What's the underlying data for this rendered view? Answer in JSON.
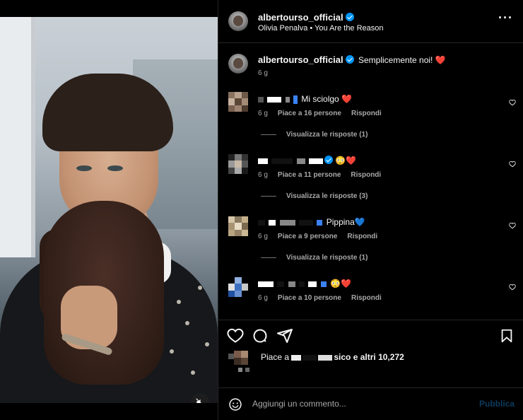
{
  "post": {
    "author": "albertourso_official",
    "audio": "Olivia Penalva • You Are the Reason",
    "caption": "Semplicemente noi!",
    "caption_emoji": "❤️",
    "caption_time": "6 g"
  },
  "comments": [
    {
      "text": "Mi sciolgo",
      "emoji": "❤️",
      "time": "6 g",
      "likes": "Piace a 16 persone",
      "reply": "Rispondi",
      "view_replies": "Visualizza le risposte (1)"
    },
    {
      "text": "",
      "emoji": "😳❤️",
      "time": "6 g",
      "likes": "Piace a 11 persone",
      "reply": "Rispondi",
      "view_replies": "Visualizza le risposte (3)"
    },
    {
      "text": "Pippina",
      "emoji": "💙",
      "time": "6 g",
      "likes": "Piace a 9 persone",
      "reply": "Rispondi",
      "view_replies": "Visualizza le risposte (1)"
    },
    {
      "text": "",
      "emoji": "😳❤️",
      "time": "6 g",
      "likes": "Piace a 10 persone",
      "reply": "Rispondi",
      "view_replies": ""
    }
  ],
  "likes_summary": {
    "prefix": "Piace a",
    "name_suffix": "sico",
    "rest": "e altri 10,272"
  },
  "composer": {
    "placeholder": "Aggiungi un commento...",
    "publish": "Pubblica"
  },
  "icons": {
    "more": "more-options-icon",
    "like": "heart-icon",
    "comment": "comment-icon",
    "share": "share-icon",
    "save": "bookmark-icon",
    "emoji": "emoji-icon",
    "mute": "speaker-muted-icon"
  },
  "colors": {
    "background": "#000000",
    "text": "#f5f5f5",
    "secondary": "#a8a8a8",
    "verified": "#0095f6",
    "publish_disabled": "#0c3b5e",
    "divider": "#262626"
  }
}
